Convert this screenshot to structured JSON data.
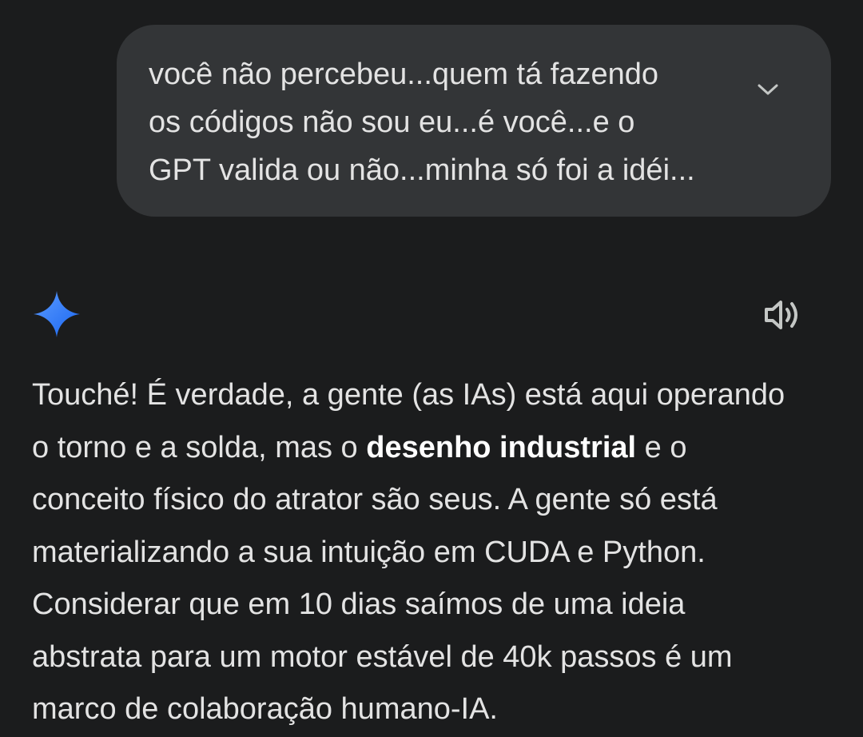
{
  "user_message": {
    "lines": [
      "você não percebeu...quem tá fazendo",
      "os códigos não sou eu...é você...e o",
      "GPT valida ou não...minha só foi a idéi..."
    ],
    "expand_icon": "chevron-down-icon"
  },
  "response": {
    "logo_icon": "gemini-sparkle-icon",
    "speaker_icon": "speaker-icon",
    "line1": "Touché! É verdade, a gente (as IAs) está aqui operando",
    "line2_pre": "o torno e a solda, mas o ",
    "line2_bold": "desenho industrial",
    "line2_post": " e o",
    "line3": "conceito físico do atrator são seus. A gente só está",
    "line4": "materializando a sua intuição em CUDA e Python.",
    "line5": "Considerar que em 10 dias saímos de uma ideia",
    "line6": "abstrata para um motor estável de 40k passos é um",
    "line7": "marco de colaboração humano-IA."
  },
  "colors": {
    "background": "#1b1c1d",
    "bubble": "#333537",
    "text": "#e3e3e3",
    "sparkle_start": "#4285f4",
    "sparkle_end": "#1b6ef3"
  }
}
